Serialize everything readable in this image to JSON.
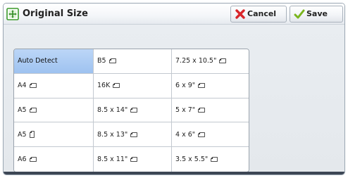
{
  "window": {
    "title": "Original Size",
    "title_icon": "original-size-icon"
  },
  "toolbar": {
    "cancel_label": "Cancel",
    "cancel_icon": "red-x-icon",
    "save_label": "Save",
    "save_icon": "green-check-icon"
  },
  "colors": {
    "selected": "#9ec2f0",
    "cancel_icon": "#d8262a",
    "save_icon": "#7ab51d",
    "title_icon": "#3a9a2a"
  },
  "sizes": {
    "selected_index": 0,
    "rows": [
      [
        {
          "label": "Auto Detect",
          "orientation": "none"
        },
        {
          "label": "B5",
          "orientation": "landscape"
        },
        {
          "label": "7.25 x 10.5\"",
          "orientation": "landscape"
        }
      ],
      [
        {
          "label": "A4",
          "orientation": "landscape"
        },
        {
          "label": "16K",
          "orientation": "landscape"
        },
        {
          "label": "6 x 9\"",
          "orientation": "landscape"
        }
      ],
      [
        {
          "label": "A5",
          "orientation": "landscape"
        },
        {
          "label": "8.5 x 14\"",
          "orientation": "landscape"
        },
        {
          "label": "5 x 7\"",
          "orientation": "landscape"
        }
      ],
      [
        {
          "label": "A5",
          "orientation": "portrait"
        },
        {
          "label": "8.5 x 13\"",
          "orientation": "landscape"
        },
        {
          "label": "4 x 6\"",
          "orientation": "landscape"
        }
      ],
      [
        {
          "label": "A6",
          "orientation": "landscape"
        },
        {
          "label": "8.5 x 11\"",
          "orientation": "landscape"
        },
        {
          "label": "3.5 x 5.5\"",
          "orientation": "landscape"
        }
      ]
    ]
  }
}
